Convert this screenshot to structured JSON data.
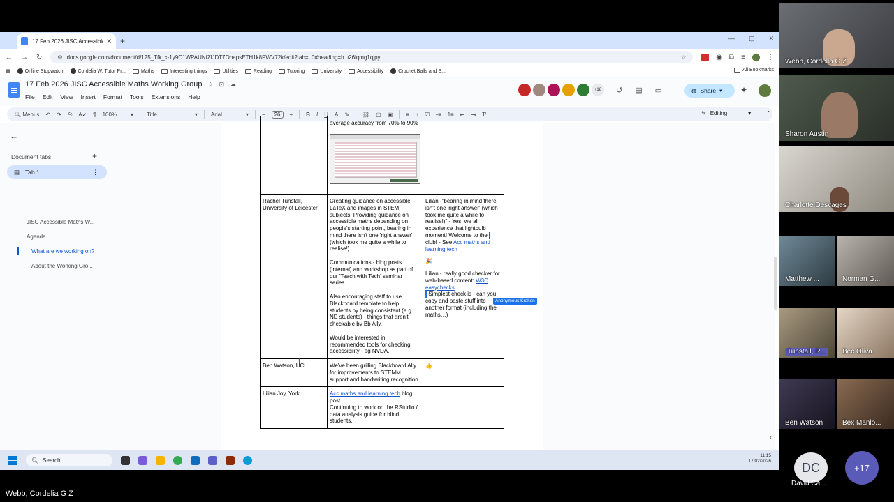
{
  "browser": {
    "tab_title": "17 Feb 2026 JISC Accessible M…",
    "new_tab": "+",
    "url": "docs.google.com/document/d/125_Tfk_x-1y9C1WPAUNfZlJDT7OoapsETH1k8PWV72k/edit?tab=t.0#heading=h.u26lqmg1qjpy",
    "bookmarks": [
      "Online Stopwatch",
      "Cordelia W. Tutor Pr...",
      "Maths",
      "Interesting things",
      "Utilities",
      "Reading",
      "Tutoring",
      "University",
      "Accessibility",
      "Crochet Balls and S..."
    ],
    "all_bookmarks": "All Bookmarks"
  },
  "doc": {
    "title": "17 Feb 2026 JISC Accessible Maths Working Group",
    "menu": [
      "File",
      "Edit",
      "View",
      "Insert",
      "Format",
      "Tools",
      "Extensions",
      "Help"
    ],
    "collab_more": "+18",
    "share_label": "Share",
    "toolbar": {
      "menus": "Menus",
      "zoom": "100%",
      "style": "Title",
      "font": "Arial",
      "font_size": "26",
      "editing": "Editing"
    }
  },
  "sidebar": {
    "tabs_title": "Document tabs",
    "tab_label": "Tab 1",
    "outline": [
      "JISC Accessible Maths W...",
      "Agenda",
      "What are we working on?",
      "About the Working Gro..."
    ]
  },
  "table": {
    "row0": {
      "col2_tail": "average accuracy from 70% to 90%"
    },
    "row1": {
      "name": "Rachel Tunstall, University of Leicester",
      "p1": "Creating guidance on accessible LaTeX and images in STEM subjects. Providing guidance on accessible maths depending on people's starting point, bearing in mind there isn't one 'right answer' (which took me quite a while to realise!).",
      "p2": "Communications - blog posts (internal) and workshop as part of our 'Teach with Tech' seminar series.",
      "p3": "Also encouraging staff to use Blackboard template to help students by being consistent (e.g. ND students) - things that aren't checkable by Bb Ally.",
      "p4": "Would be interested in recommended tools for checking accessibility - eg NVDA.",
      "c1": "Lilian -\"bearing in mind there isn't one 'right answer' (which took me quite a while to realise!)\" - Yes, we all experience that lightbulb moment! Welcome to the",
      "c1b": "club! - See",
      "c1_link": "Acc maths and learning tech",
      "c2": "Lilian - really good checker for web-based content:",
      "c2_link": "W3C easychecks",
      "c3": "Simplest check is - can you copy and paste stuff into another format (including the maths…)",
      "cursor_label": "Anonymous Kraken"
    },
    "row2": {
      "name": "Ben Watson, UCL",
      "work": "We've been grilling Blackboard Ally for improvements to STEMM support and handwriting recognition."
    },
    "row3": {
      "name": "Lilian Joy, York",
      "link": "Acc maths and learning tech",
      "tail": " blog post.",
      "work2": "Continuing to work on the RStudio / data analysis guide for blind students."
    }
  },
  "taskbar": {
    "search": "Search",
    "time": "11:15",
    "date": "17/02/2026"
  },
  "participants": [
    "Webb, Cordelia G Z",
    "Sharon Austin",
    "Charlotte Desvages",
    "Matthew ...",
    "Norman G...",
    "Tunstall, R...",
    "Bec Oliva",
    "Ben Watson",
    "Bex Manlo..."
  ],
  "david": {
    "initials": "DC",
    "name": "David Ca..."
  },
  "more_participants": "+17",
  "presenter": "Webb, Cordelia G Z"
}
